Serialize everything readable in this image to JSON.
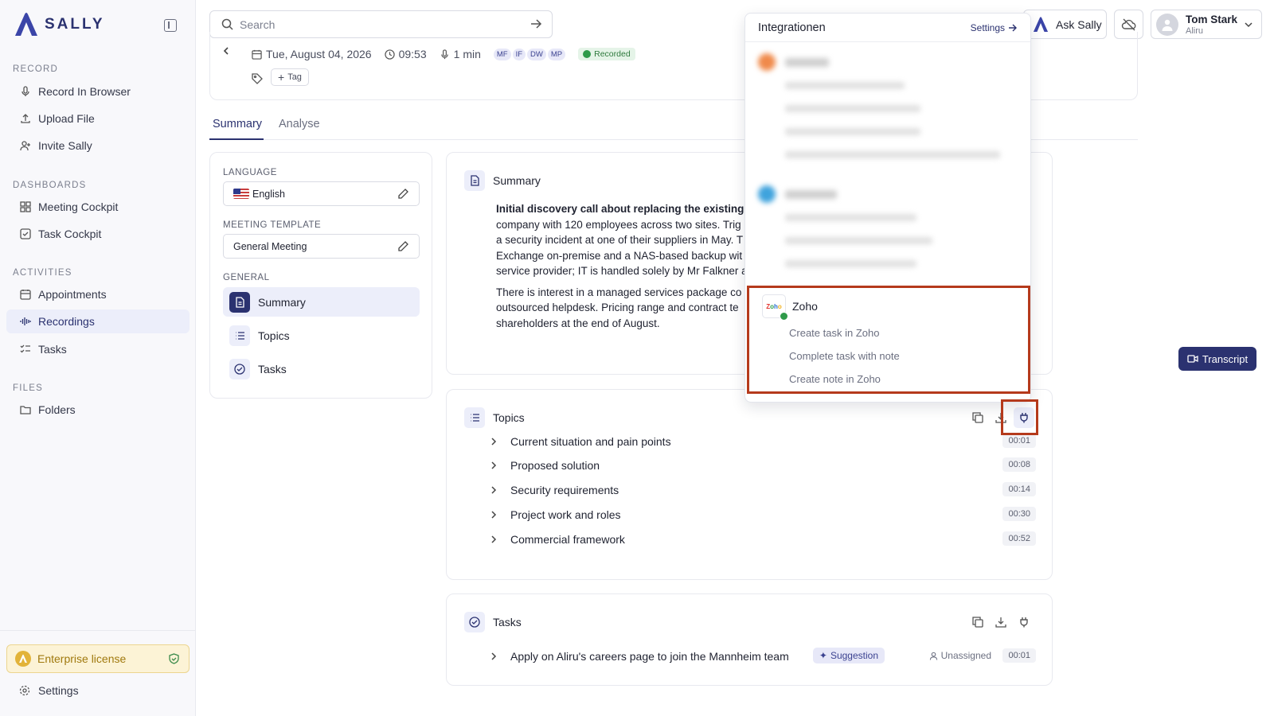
{
  "app": {
    "name": "SALLY"
  },
  "sidebar": {
    "sections": {
      "record": "RECORD",
      "dashboards": "DASHBOARDS",
      "activities": "ACTIVITIES",
      "files": "FILES"
    },
    "items": {
      "record_in_browser": "Record In Browser",
      "upload_file": "Upload File",
      "invite_sally": "Invite Sally",
      "meeting_cockpit": "Meeting Cockpit",
      "task_cockpit": "Task Cockpit",
      "appointments": "Appointments",
      "recordings": "Recordings",
      "tasks": "Tasks",
      "folders": "Folders"
    },
    "license": "Enterprise license",
    "settings": "Settings"
  },
  "topbar": {
    "search_placeholder": "Search",
    "ask_sally": "Ask Sally",
    "user": {
      "name": "Tom Stark",
      "org": "Aliru"
    }
  },
  "meeting": {
    "date": "Tue, August 04, 2026",
    "time": "09:53",
    "duration": "1 min",
    "participants": [
      "MF",
      "IF",
      "DW",
      "MP"
    ],
    "status": "Recorded",
    "tag_label": "Tag"
  },
  "tabs": {
    "summary": "Summary",
    "analyse": "Analyse"
  },
  "config": {
    "language_label": "LANGUAGE",
    "language": "English",
    "template_label": "MEETING TEMPLATE",
    "template": "General Meeting",
    "general_label": "GENERAL",
    "sections": [
      "Summary",
      "Topics",
      "Tasks"
    ]
  },
  "summary_card": {
    "title": "Summary",
    "lines_p1": [
      "Initial discovery call about replacing the existing c",
      "company with 120 employees across two sites. Trig",
      "a security incident at one of their suppliers in May. T",
      "Exchange on-premise and a NAS-based backup wit",
      "service provider; IT is handled solely by Mr Falkner a"
    ],
    "lines_p2": [
      "There is interest in a managed services package co",
      "outsourced helpdesk. Pricing range and contract te",
      "shareholders at the end of August."
    ]
  },
  "topics_card": {
    "title": "Topics",
    "items": [
      {
        "label": "Current situation and pain points",
        "time": "00:01"
      },
      {
        "label": "Proposed solution",
        "time": "00:08"
      },
      {
        "label": "Security requirements",
        "time": "00:14"
      },
      {
        "label": "Project work and roles",
        "time": "00:30"
      },
      {
        "label": "Commercial framework",
        "time": "00:52"
      }
    ]
  },
  "tasks_card": {
    "title": "Tasks",
    "items": [
      {
        "label": "Apply on Aliru's careers page to join the Mannheim team",
        "badge": "Suggestion",
        "assignee": "Unassigned",
        "time": "00:01"
      }
    ]
  },
  "transcript_button": "Transcript",
  "integrations": {
    "title": "Integrationen",
    "settings": "Settings",
    "zoho": {
      "name": "Zoho",
      "actions": [
        "Create task in Zoho",
        "Complete task with note",
        "Create note in Zoho"
      ]
    }
  }
}
